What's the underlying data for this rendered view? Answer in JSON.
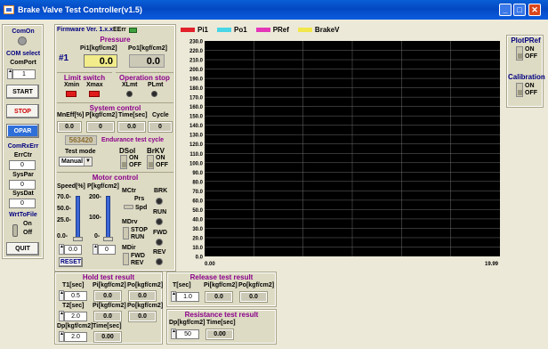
{
  "window": {
    "title": "Brake Valve Test Controller(v1.5)"
  },
  "legend": [
    {
      "name": "Pi1",
      "color": "#e2212b"
    },
    {
      "name": "Po1",
      "color": "#49d6e6"
    },
    {
      "name": "PRef",
      "color": "#e536b8"
    },
    {
      "name": "BrakeV",
      "color": "#f2e74a"
    }
  ],
  "sidebar": {
    "com_on": "ComOn",
    "com_select": "COM select",
    "com_port": "ComPort",
    "com_port_value": "1",
    "start": "START",
    "stop": "STOP",
    "opar": "OPAR",
    "com_rx_err": "ComRxErr",
    "err_ctr": "ErrCtr",
    "err_ctr_value": "0",
    "sys_par": "SysPar",
    "sys_par_value": "0",
    "sys_dat": "SysDat",
    "sys_dat_value": "0",
    "wrt_to_file": "WrtToFile",
    "on": "On",
    "off": "Off",
    "quit": "QUIT"
  },
  "firmware": {
    "label": "Firmware Ver. 1.x.x",
    "err": "EErr"
  },
  "pressure": {
    "title": "Pressure",
    "channel": "#1",
    "pi1_label": "Pi1[kgf/cm2]",
    "pi1_value": "0.0",
    "po1_label": "Po1[kgf/cm2]",
    "po1_value": "0.0"
  },
  "limit_switch": {
    "title": "Limit switch",
    "xmin": "Xmin",
    "xmax": "Xmax"
  },
  "operation_stop": {
    "title": "Operation stop",
    "xlmt": "XLmt",
    "plmt": "PLmt"
  },
  "system_control": {
    "title": "System control",
    "headers": [
      "MnEff[%]",
      "P[kgf/cm2]",
      "Time[sec]",
      "Cycle"
    ],
    "values": [
      "0.0",
      "0",
      "0.0",
      "0"
    ],
    "cycle_count": "563420",
    "endurance_label": "Endurance test cycle",
    "test_mode_label": "Test mode",
    "test_mode_value": "Manual",
    "dsol": "DSol",
    "brkv": "BrKV",
    "on": "ON",
    "off": "OFF"
  },
  "motor_control": {
    "title": "Motor control",
    "speed_label": "Speed[%]",
    "p_label": "P[kgf/cm2]",
    "speed_ticks": [
      "70.0-",
      "50.0-",
      "25.0-",
      "0.0-"
    ],
    "p_ticks": [
      "200-",
      "100-",
      "0-"
    ],
    "speed_value": "0.0",
    "p_value": "0",
    "mctr": "MCtr",
    "prs": "Prs",
    "spd": "Spd",
    "mdrv": "MDrv",
    "stop": "STOP",
    "run": "RUN",
    "mdir": "MDir",
    "fwd": "FWD",
    "rev": "REV",
    "brk": "BRK",
    "run_led": "RUN",
    "fwd_led": "FWD",
    "rev_led": "REV",
    "reset": "RESET",
    "speed_level": 0.0,
    "p_level": 0.0
  },
  "chart_data": {
    "type": "line",
    "y_ticks": [
      "230.0",
      "220.0",
      "210.0",
      "200.0",
      "190.0",
      "180.0",
      "170.0",
      "160.0",
      "150.0",
      "140.0",
      "130.0",
      "120.0",
      "110.0",
      "100.0",
      "90.0",
      "80.0",
      "70.0",
      "60.0",
      "50.0",
      "40.0",
      "30.0",
      "20.0",
      "10.0",
      "0.0"
    ],
    "x_start": "0.00",
    "x_end": "19.99",
    "ylim": [
      0,
      230
    ],
    "xlim": [
      0,
      19.99
    ],
    "grid": true,
    "series": []
  },
  "plot_pref": {
    "title": "PlotPRef",
    "on": "ON",
    "off": "OFF"
  },
  "calibration": {
    "title": "Calibration",
    "on": "ON",
    "off": "OFF"
  },
  "hold_test": {
    "title": "Hold test result",
    "t1_label": "T1[sec]",
    "t1_value": "0.5",
    "pi_label": "Pi[kgf/cm2]",
    "pi_value": "0.0",
    "po_label": "Po[kgf/cm2]",
    "po_value": "0.0",
    "t2_label": "T2[sec]",
    "t2_value": "2.0",
    "pi2_value": "0.0",
    "po2_value": "0.0",
    "dp_label": "Dp[kgf/cm2]",
    "dp_value": "2.0",
    "time_label": "Time[sec]",
    "time_value": "0.00"
  },
  "release_test": {
    "title": "Release test result",
    "t_label": "T[sec]",
    "t_value": "1.0",
    "pi_label": "Pi[kgf/cm2]",
    "pi_value": "0.0",
    "po_label": "Po[kgf/cm2]",
    "po_value": "0.0"
  },
  "resistance_test": {
    "title": "Resistance test result",
    "dp_label": "Dp[kgf/cm2]",
    "dp_value": "50",
    "time_label": "Time[sec]",
    "time_value": "0.00"
  }
}
